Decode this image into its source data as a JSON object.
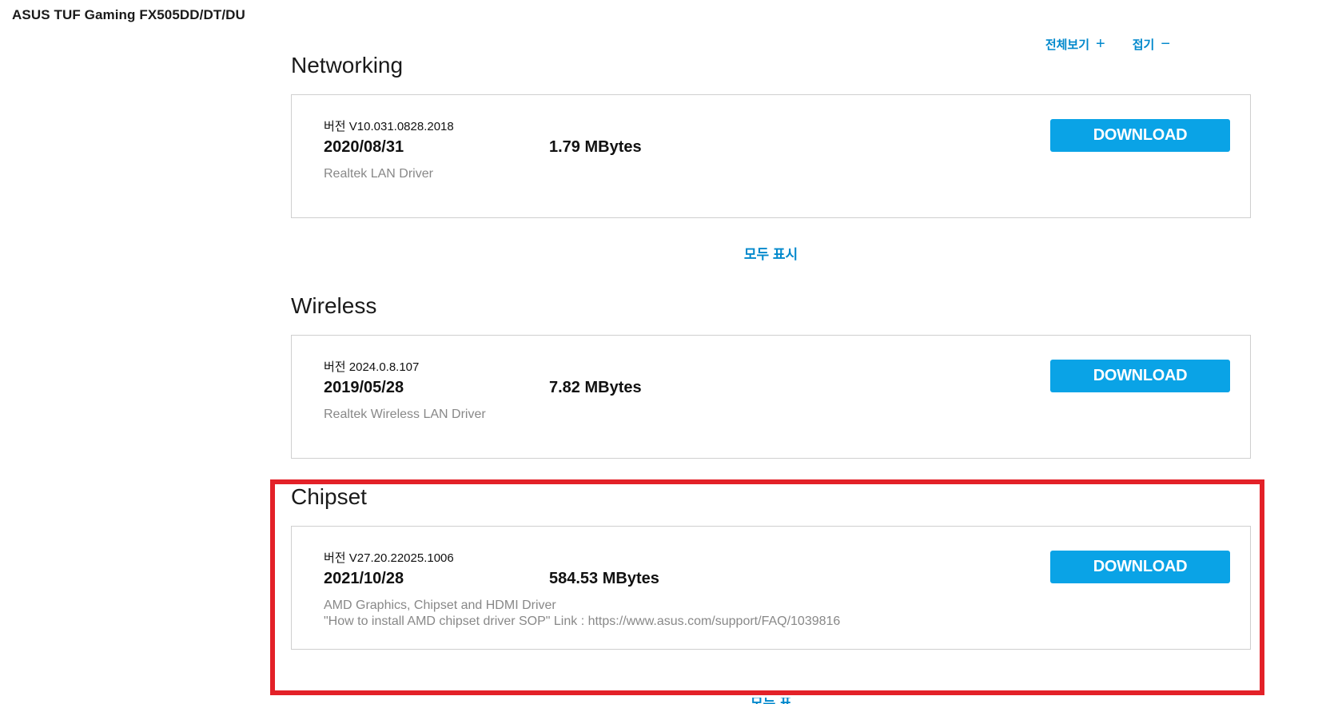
{
  "product": {
    "title": "ASUS TUF Gaming FX505DD/DT/DU"
  },
  "controls": {
    "expand_all_label": "전체보기",
    "expand_symbol": "+",
    "collapse_label": "접기",
    "collapse_symbol": "−"
  },
  "sections": [
    {
      "heading": "Networking",
      "item": {
        "version_prefix": "버전",
        "version": "V10.031.0828.2018",
        "date": "2020/08/31",
        "size": "1.79 MBytes",
        "description_lines": [
          "Realtek LAN Driver"
        ],
        "download_label": "DOWNLOAD"
      },
      "show_all_label": "모두 표시"
    },
    {
      "heading": "Wireless",
      "item": {
        "version_prefix": "버전",
        "version": "2024.0.8.107",
        "date": "2019/05/28",
        "size": "7.82 MBytes",
        "description_lines": [
          "Realtek Wireless LAN Driver"
        ],
        "download_label": "DOWNLOAD"
      }
    },
    {
      "heading": "Chipset",
      "item": {
        "version_prefix": "버전",
        "version": "V27.20.22025.1006",
        "date": "2021/10/28",
        "size": "584.53 MBytes",
        "description_lines": [
          "AMD Graphics, Chipset and HDMI Driver",
          "\"How to install AMD chipset driver SOP\" Link : https://www.asus.com/support/FAQ/1039816"
        ],
        "download_label": "DOWNLOAD"
      },
      "show_all_label": "모두 표시"
    }
  ],
  "colors": {
    "accent_blue": "#0aa3e6",
    "link_blue": "#0088cc",
    "highlight_red": "#e32128",
    "card_border": "#cfcfcf",
    "description_gray": "#888888"
  }
}
